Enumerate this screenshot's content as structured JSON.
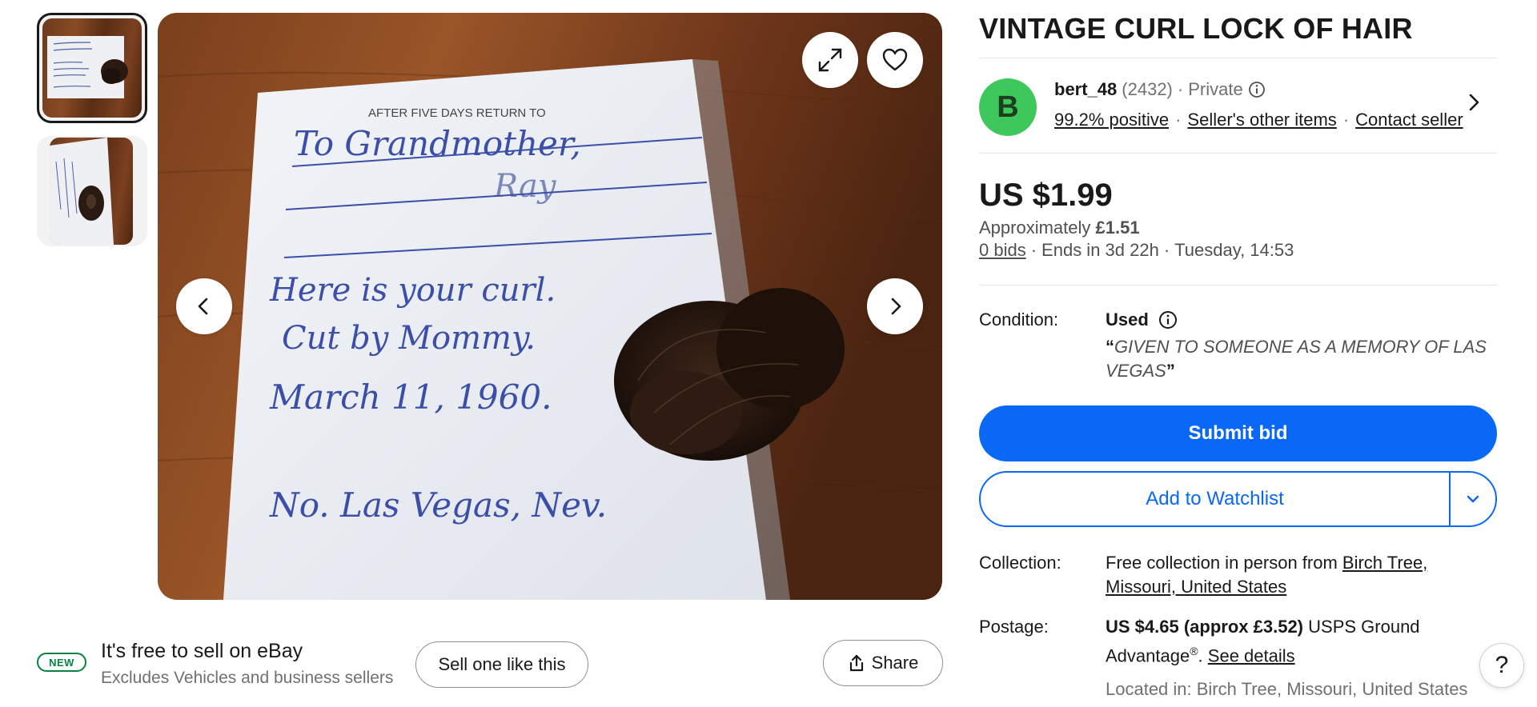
{
  "listing": {
    "title": "VINTAGE CURL LOCK OF HAIR"
  },
  "photo": {
    "note_lines": [
      "AFTER FIVE DAYS RETURN TO",
      "To Grandmother,",
      "Ray",
      "Here is your curl.",
      "Cut by Mommy.",
      "March 11, 1960.",
      "No. Las Vegas, Nev."
    ]
  },
  "icons": {
    "expand": "expand-icon",
    "favorite": "heart-icon",
    "prev": "chevron-left-icon",
    "next": "chevron-right-icon",
    "share": "share-icon",
    "help": "question-icon"
  },
  "seller": {
    "avatar_letter": "B",
    "name": "bert_48",
    "score": "(2432)",
    "dot1": "·",
    "type": "Private",
    "positive": "99.2% positive",
    "dot2": "·",
    "other_items": "Seller's other items",
    "dot3": "·",
    "contact": "Contact seller"
  },
  "price": {
    "main": "US $1.99",
    "approx_prefix": "Approximately",
    "approx_value": "£1.51",
    "bids": "0 bids",
    "dot1": "·",
    "ends": "Ends in 3d 22h",
    "dot2": "·",
    "end_time": "Tuesday, 14:53"
  },
  "condition": {
    "label": "Condition:",
    "value": "Used",
    "quote": "GIVEN TO SOMEONE AS A MEMORY OF LAS VEGAS",
    "open_quote": "“",
    "close_quote": "”"
  },
  "actions": {
    "submit_bid": "Submit bid",
    "watchlist": "Add to Watchlist"
  },
  "collection": {
    "label": "Collection:",
    "prefix": "Free collection in person from",
    "location_link": "Birch Tree, Missouri, United States"
  },
  "postage": {
    "label": "Postage:",
    "cost": "US $4.65 (approx £3.52)",
    "service": "USPS Ground Advantage",
    "reg": "®",
    "period": ".",
    "details": "See details",
    "located": "Located in: Birch Tree, Missouri, United States"
  },
  "sell": {
    "badge": "NEW",
    "title": "It's free to sell on eBay",
    "subtitle": "Excludes Vehicles and business sellers",
    "sell_button": "Sell one like this",
    "share_button": "Share"
  },
  "help": {
    "label": "?"
  },
  "colors": {
    "accent": "#0968f6",
    "avatar": "#3ec75a",
    "new_badge": "#05823f"
  }
}
